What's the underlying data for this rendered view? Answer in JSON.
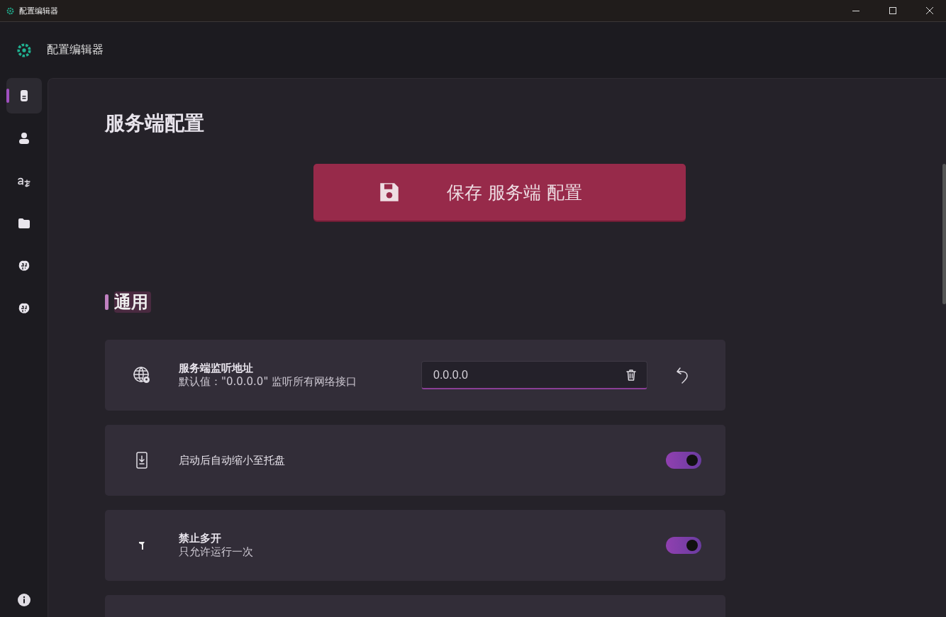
{
  "window": {
    "title": "配置编辑器"
  },
  "header": {
    "title": "配置编辑器"
  },
  "sidebar": {
    "items": [
      {
        "selected": true
      },
      {
        "selected": false
      },
      {
        "selected": false
      },
      {
        "selected": false
      },
      {
        "selected": false
      },
      {
        "selected": false
      }
    ]
  },
  "page": {
    "title": "服务端配置",
    "save_button": "保存 服务端 配置"
  },
  "section": {
    "title": "通用"
  },
  "settings": [
    {
      "kind": "input",
      "title": "服务端监听地址",
      "description": "默认值：\"0.0.0.0\" 监听所有网络接口",
      "value": "0.0.0.0"
    },
    {
      "kind": "toggle",
      "title": "启动后自动缩小至托盘",
      "on": true
    },
    {
      "kind": "toggle",
      "title": "禁止多开",
      "description": "只允许运行一次",
      "on": true
    },
    {
      "kind": "blank"
    }
  ]
}
